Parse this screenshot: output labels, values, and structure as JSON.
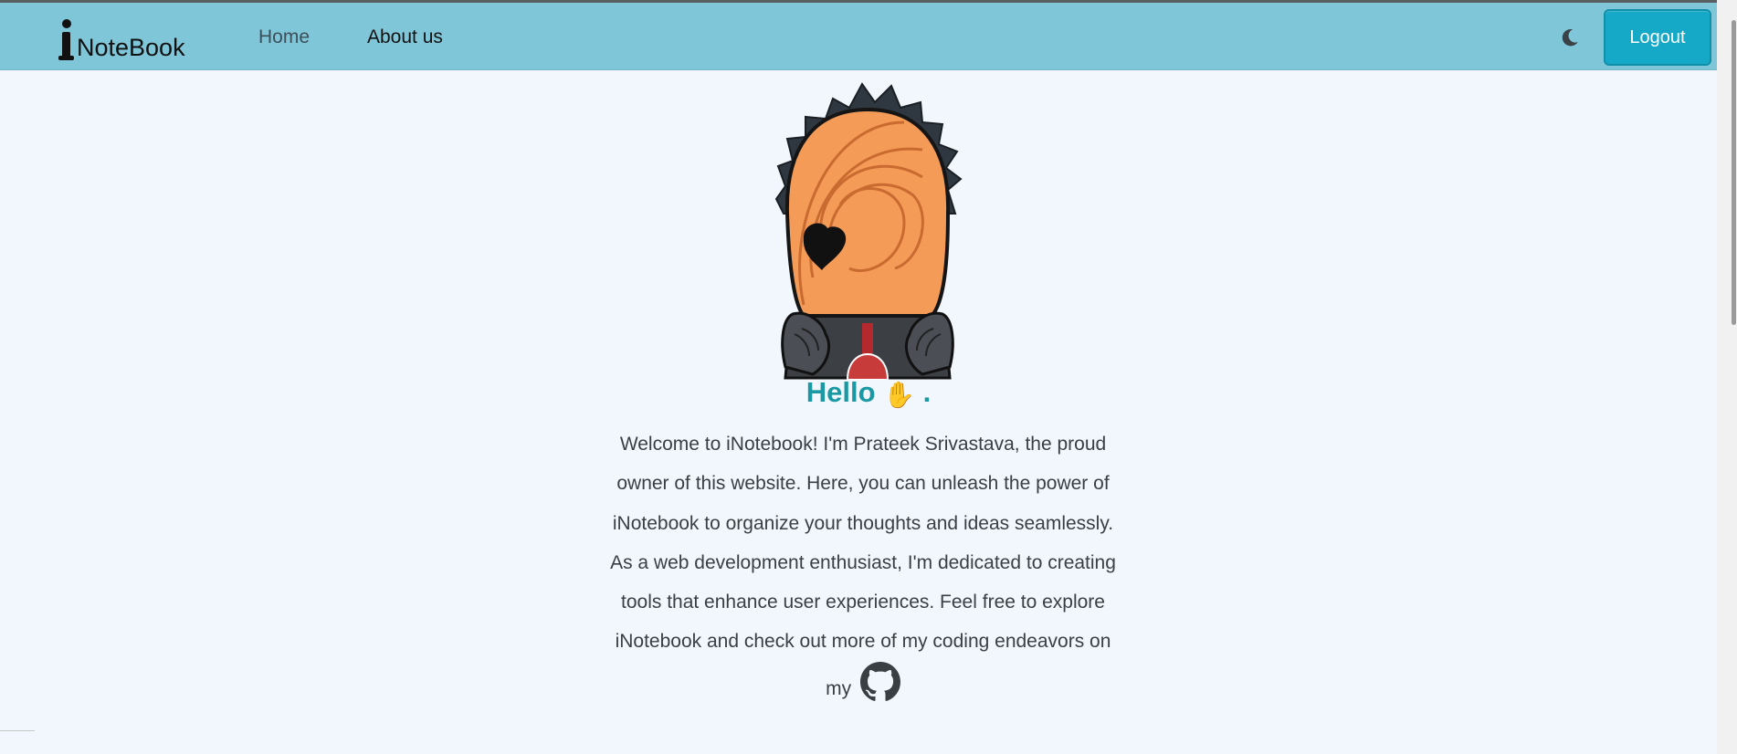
{
  "navbar": {
    "brand": {
      "letter": "i",
      "text": "NoteBook"
    },
    "links": [
      {
        "label": "Home"
      },
      {
        "label": "About us"
      }
    ],
    "theme_toggle_icon": "moon-icon",
    "logout_label": "Logout"
  },
  "hero": {
    "image": "masked-character-illustration"
  },
  "greeting": {
    "text": "Hello",
    "emoji": "✋",
    "suffix": "."
  },
  "welcome": {
    "text": "Welcome to iNotebook! I'm Prateek Srivastava, the proud owner of this website. Here, you can unleash the power of iNotebook to organize your thoughts and ideas seamlessly. As a web development enthusiast, I'm dedicated to creating tools that enhance user experiences. Feel free to explore iNotebook and check out more of my coding endeavors on my",
    "link_icon": "github-icon"
  },
  "colors": {
    "navbar": "#80c6d9",
    "page_bg": "#f1f7fd",
    "accent": "#1a98a3",
    "button": "#15a9c7"
  }
}
